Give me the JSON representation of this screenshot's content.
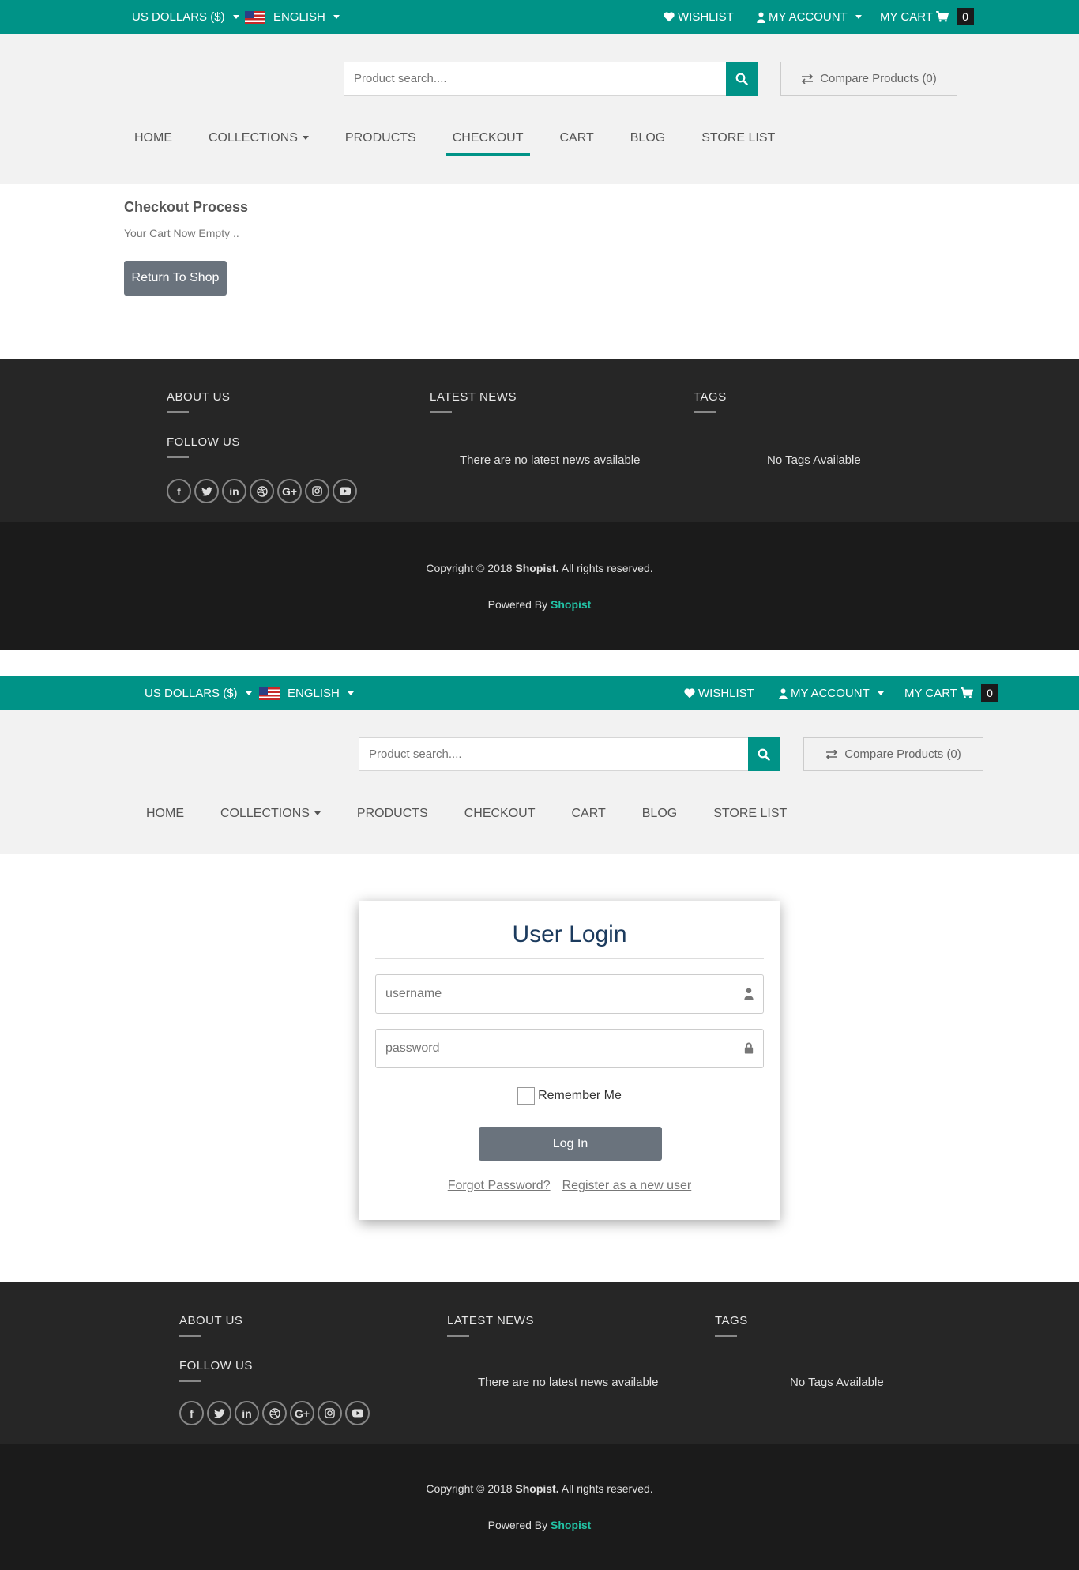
{
  "topbar": {
    "currency": "US DOLLARS ($)",
    "language": "ENGLISH",
    "wishlist": "WISHLIST",
    "account": "MY ACCOUNT",
    "cart": "MY CART",
    "cart_count": "0"
  },
  "search": {
    "placeholder": "Product search...."
  },
  "compare": {
    "label": "Compare Products (0)"
  },
  "nav": {
    "items": [
      {
        "label": "HOME"
      },
      {
        "label": "COLLECTIONS"
      },
      {
        "label": "PRODUCTS"
      },
      {
        "label": "CHECKOUT"
      },
      {
        "label": "CART"
      },
      {
        "label": "BLOG"
      },
      {
        "label": "STORE LIST"
      }
    ],
    "active": "CHECKOUT"
  },
  "checkout": {
    "title": "Checkout Process",
    "empty_message": "Your Cart Now Empty ..",
    "return_button": "Return To Shop"
  },
  "footer": {
    "about_us": "ABOUT US",
    "follow_us": "FOLLOW US",
    "latest_news": "LATEST NEWS",
    "latest_news_empty": "There are no latest news available",
    "tags": "TAGS",
    "tags_empty": "No Tags Available",
    "copyright_prefix": "Copyright © 2018 ",
    "copyright_brand": "Shopist.",
    "copyright_suffix": " All rights reserved.",
    "powered_prefix": "Powered By ",
    "powered_brand": "Shopist",
    "social_icons": [
      "facebook-icon",
      "twitter-icon",
      "linkedin-icon",
      "dribbble-icon",
      "google-plus-icon",
      "instagram-icon",
      "youtube-icon"
    ]
  },
  "login": {
    "title": "User Login",
    "username_placeholder": "username",
    "password_placeholder": "password",
    "remember_me": "Remember Me",
    "login_button": "Log In",
    "forgot_password": "Forgot Password?",
    "register": "Register as a new user"
  },
  "colors": {
    "brand_teal": "#009387",
    "footer_dark": "#262626",
    "footer_darker": "#1b1b1b",
    "button_gray": "#6a737d",
    "accent_link": "#22c3a6"
  }
}
